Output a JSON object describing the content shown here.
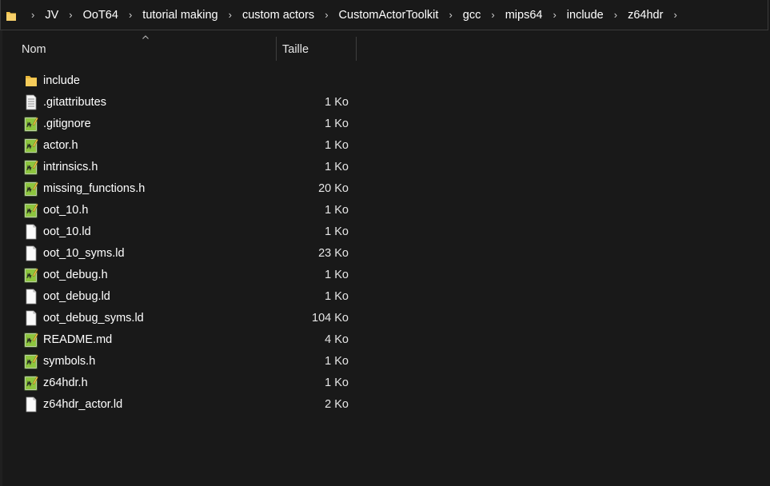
{
  "breadcrumb": [
    {
      "label": "JV"
    },
    {
      "label": "OoT64"
    },
    {
      "label": "tutorial making"
    },
    {
      "label": "custom actors"
    },
    {
      "label": "CustomActorToolkit"
    },
    {
      "label": "gcc"
    },
    {
      "label": "mips64"
    },
    {
      "label": "include"
    },
    {
      "label": "z64hdr"
    }
  ],
  "columns": {
    "name": "Nom",
    "size": "Taille"
  },
  "files": [
    {
      "name": "include",
      "size": "",
      "icon": "folder-icon"
    },
    {
      "name": ".gitattributes",
      "size": "1 Ko",
      "icon": "text-file-icon"
    },
    {
      "name": ".gitignore",
      "size": "1 Ko",
      "icon": "notepad-plus-file-icon"
    },
    {
      "name": "actor.h",
      "size": "1 Ko",
      "icon": "notepad-plus-file-icon"
    },
    {
      "name": "intrinsics.h",
      "size": "1 Ko",
      "icon": "notepad-plus-file-icon"
    },
    {
      "name": "missing_functions.h",
      "size": "20 Ko",
      "icon": "notepad-plus-file-icon"
    },
    {
      "name": "oot_10.h",
      "size": "1 Ko",
      "icon": "notepad-plus-file-icon"
    },
    {
      "name": "oot_10.ld",
      "size": "1 Ko",
      "icon": "blank-file-icon"
    },
    {
      "name": "oot_10_syms.ld",
      "size": "23 Ko",
      "icon": "blank-file-icon"
    },
    {
      "name": "oot_debug.h",
      "size": "1 Ko",
      "icon": "notepad-plus-file-icon"
    },
    {
      "name": "oot_debug.ld",
      "size": "1 Ko",
      "icon": "blank-file-icon"
    },
    {
      "name": "oot_debug_syms.ld",
      "size": "104 Ko",
      "icon": "blank-file-icon"
    },
    {
      "name": "README.md",
      "size": "4 Ko",
      "icon": "notepad-plus-file-icon"
    },
    {
      "name": "symbols.h",
      "size": "1 Ko",
      "icon": "notepad-plus-file-icon"
    },
    {
      "name": "z64hdr.h",
      "size": "1 Ko",
      "icon": "notepad-plus-file-icon"
    },
    {
      "name": "z64hdr_actor.ld",
      "size": "2 Ko",
      "icon": "blank-file-icon"
    }
  ],
  "colors": {
    "background": "#191919",
    "folder": "#f0c34a",
    "text": "#ffffff"
  }
}
